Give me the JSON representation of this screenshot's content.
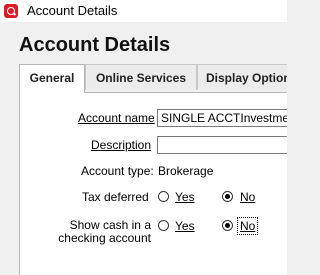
{
  "window": {
    "title": "Account Details"
  },
  "header": {
    "title": "Account Details"
  },
  "tabs": [
    {
      "label": "General"
    },
    {
      "label": "Online Services"
    },
    {
      "label": "Display Options"
    }
  ],
  "form": {
    "account_name": {
      "label": "Account name",
      "value": "SINGLE ACCTInvestment"
    },
    "description": {
      "label": "Description",
      "value": ""
    },
    "account_type": {
      "label": "Account type:",
      "value": "Brokerage"
    },
    "tax_deferred": {
      "label": "Tax deferred",
      "yes": "Yes",
      "no": "No",
      "selected": "No"
    },
    "show_cash": {
      "label_line1": "Show cash in a",
      "label_line2": "checking account",
      "yes": "Yes",
      "no": "No",
      "selected": "No"
    }
  },
  "icons": {
    "app": "quicken-logo-icon"
  },
  "colors": {
    "brand": "#d71e28"
  }
}
